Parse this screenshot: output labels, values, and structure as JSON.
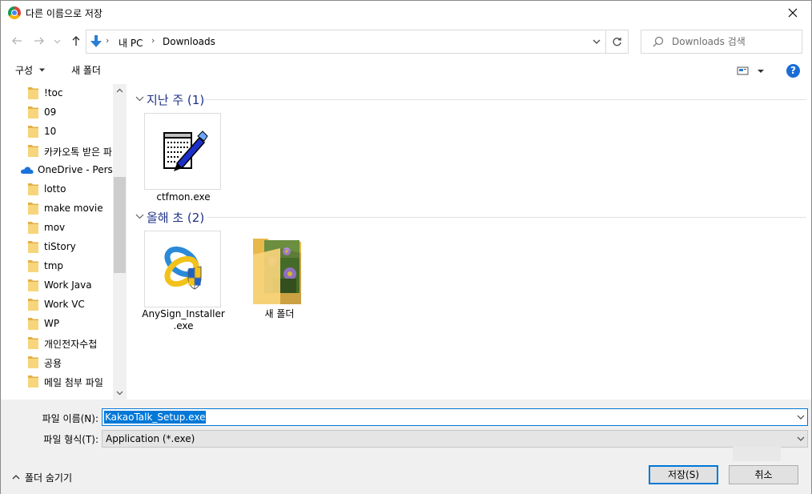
{
  "window": {
    "title": "다른 이름으로 저장"
  },
  "nav": {
    "breadcrumbs": [
      "내 PC",
      "Downloads"
    ],
    "search_placeholder": "Downloads 검색"
  },
  "toolbar": {
    "organize": "구성",
    "new_folder": "새 폴더"
  },
  "sidebar": {
    "items": [
      {
        "label": "!toc",
        "type": "folder"
      },
      {
        "label": "09",
        "type": "folder"
      },
      {
        "label": "10",
        "type": "folder"
      },
      {
        "label": "카카오톡 받은 파",
        "type": "folder"
      },
      {
        "label": "OneDrive - Person",
        "type": "onedrive"
      },
      {
        "label": "lotto",
        "type": "folder"
      },
      {
        "label": "make movie",
        "type": "folder"
      },
      {
        "label": "mov",
        "type": "folder"
      },
      {
        "label": "tiStory",
        "type": "folder"
      },
      {
        "label": "tmp",
        "type": "folder"
      },
      {
        "label": "Work Java",
        "type": "folder"
      },
      {
        "label": "Work VC",
        "type": "folder"
      },
      {
        "label": "WP",
        "type": "folder"
      },
      {
        "label": "개인전자수첩",
        "type": "folder"
      },
      {
        "label": "공용",
        "type": "folder"
      },
      {
        "label": "메일 첨부 파일",
        "type": "folder"
      }
    ]
  },
  "groups": [
    {
      "title": "지난 주 (1)",
      "items": [
        {
          "name": "ctfmon.exe",
          "icon": "notepad-pen-icon"
        }
      ]
    },
    {
      "title": "올해 초 (2)",
      "items": [
        {
          "name": "AnySign_Installer.exe",
          "name_line1": "AnySign_Installer",
          "name_line2": ".exe",
          "icon": "anysign-installer-icon"
        },
        {
          "name": "새 폴더",
          "icon": "photo-folder-icon"
        }
      ]
    }
  ],
  "bottom": {
    "file_name_label": "파일 이름(N):",
    "file_name_value": "KakaoTalk_Setup.exe",
    "file_type_label": "파일 형식(T):",
    "file_type_value": "Application (*.exe)",
    "hide_folders": "폴더 숨기기",
    "save": "저장(S)",
    "cancel": "취소"
  },
  "colors": {
    "accent": "#0078d7",
    "group_title": "#1e3287",
    "help": "#1a6dd6"
  }
}
